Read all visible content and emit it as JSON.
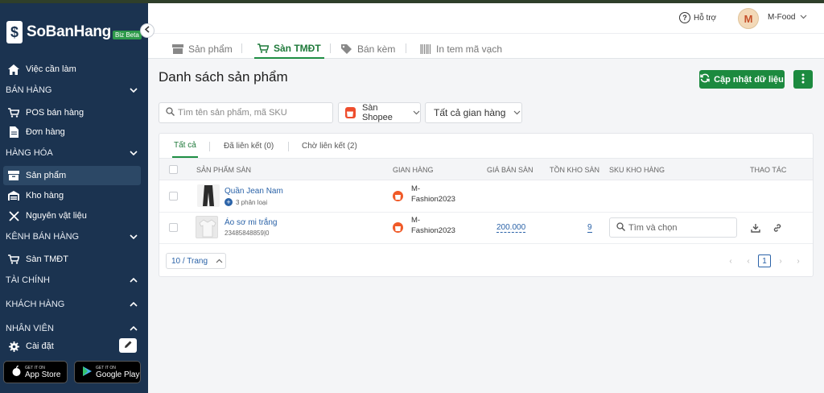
{
  "brand": {
    "name": "SoBanHang",
    "badge": "Biz Beta"
  },
  "sidebar": {
    "todo": "Việc cần làm",
    "sections": {
      "sales": "BÁN HÀNG",
      "goods": "HÀNG HÓA",
      "channels": "KÊNH BÁN HÀNG",
      "finance": "TÀI CHÍNH",
      "customers": "KHÁCH HÀNG",
      "staff": "NHÂN VIÊN"
    },
    "items": {
      "pos": "POS bán hàng",
      "orders": "Đơn hàng",
      "products": "Sản phẩm",
      "warehouse": "Kho hàng",
      "materials": "Nguyên vật liệu",
      "ecommerce": "Sàn TMĐT",
      "settings": "Cài đặt"
    },
    "stores": {
      "appstore_small": "GET IT ON",
      "appstore": "App Store",
      "googleplay_small": "GET IT ON",
      "googleplay": "Google Play"
    }
  },
  "header": {
    "help": "Hỗ trợ",
    "avatar_letter": "M",
    "user": "M-Food"
  },
  "tabs": [
    "Sản phẩm",
    "Sàn TMĐT",
    "Bán kèm",
    "In tem mã vạch"
  ],
  "main": {
    "title": "Danh sách sản phẩm",
    "update_button": "Cập nhật dữ liệu",
    "search_placeholder": "Tìm tên sản phẩm, mã SKU",
    "channel_select": "Sàn Shopee",
    "store_select": "Tất cả gian hàng"
  },
  "subtabs": [
    "Tất cả",
    "Đã liên kết (0)",
    "Chờ liên kết (2)"
  ],
  "table": {
    "headers": [
      "SẢN PHẨM SÀN",
      "GIAN HÀNG",
      "GIÁ BÁN SÀN",
      "TỒN KHO SÀN",
      "SKU KHO HÀNG",
      "THAO TÁC"
    ],
    "rows": [
      {
        "name": "Quần Jean Nam",
        "sub": "3 phân loại",
        "shop_line1": "M-",
        "shop_line2": "Fashion2023"
      },
      {
        "name": "Áo sơ mi trắng",
        "sub": "23485848859|0",
        "shop_line1": "M-",
        "shop_line2": "Fashion2023",
        "price": "200.000",
        "stock": "9",
        "sku_placeholder": "Tìm và chọn"
      }
    ]
  },
  "pagination": {
    "page_size": "10 / Trang",
    "current": "1"
  },
  "colors": {
    "sidebar": "#1b3350",
    "accent": "#1c8a3f",
    "link": "#2b63a8",
    "shopee": "#ee4d2d"
  }
}
